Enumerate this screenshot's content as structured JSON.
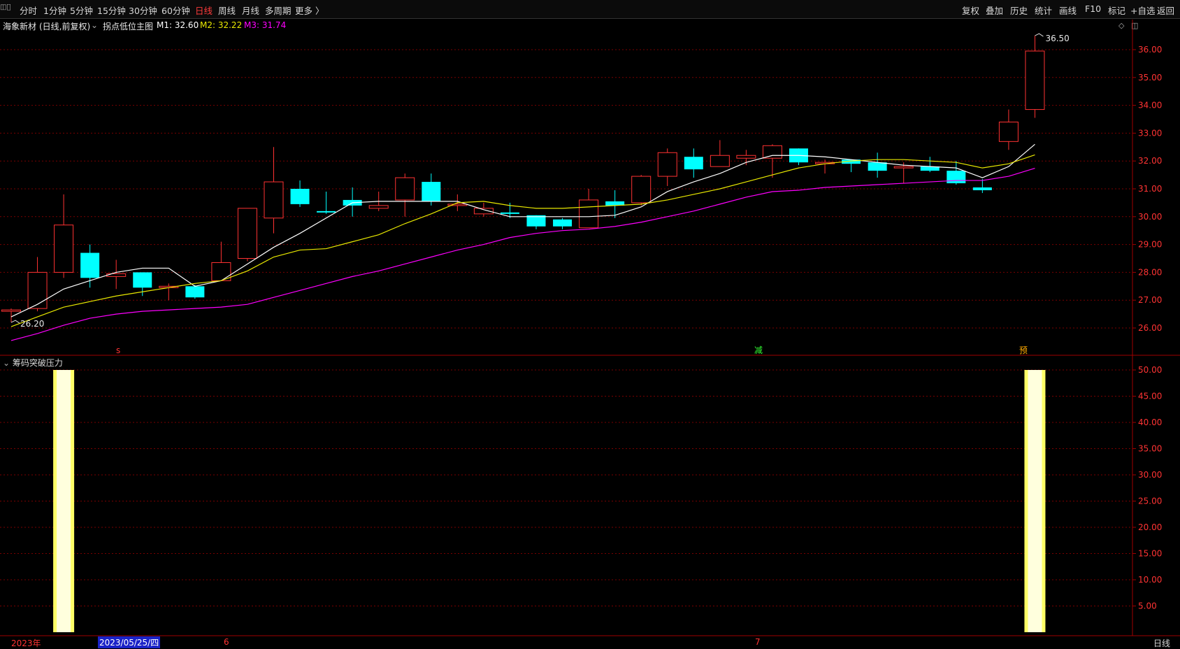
{
  "toolbar": {
    "left": [
      {
        "label": "分时",
        "active": false
      },
      {
        "label": "1分钟",
        "active": false
      },
      {
        "label": "5分钟",
        "active": false
      },
      {
        "label": "15分钟",
        "active": false
      },
      {
        "label": "30分钟",
        "active": false
      },
      {
        "label": "60分钟",
        "active": false
      },
      {
        "label": "日线",
        "active": true
      },
      {
        "label": "周线",
        "active": false
      },
      {
        "label": "月线",
        "active": false
      },
      {
        "label": "多周期",
        "active": false
      },
      {
        "label": "更多 〉",
        "active": false
      }
    ],
    "right": [
      "复权",
      "叠加",
      "历史",
      "统计",
      "画线",
      "F10",
      "标记",
      "+自选",
      "返回"
    ]
  },
  "info": {
    "stock": "海象新材",
    "period_desc": "(日线,前复权)",
    "indicator": "拐点低位主图",
    "m1": "M1: 32.60",
    "m2": "M2: 32.22",
    "m3": "M3: 31.74"
  },
  "indicator_panel": {
    "title": "筹码突破压力"
  },
  "bottom": {
    "year_label": "2023年",
    "selected_date": "2023/05/25/四",
    "month_6": "6",
    "month_7": "7",
    "period": "日线"
  },
  "markers": {
    "s": "s",
    "zeng": "减",
    "yu": "预"
  },
  "colors": {
    "up": "#ff3232",
    "down": "#00ffff",
    "m1": "#ffffff",
    "m2": "#e8e800",
    "m3": "#ff00ff",
    "grid": "#7a0000",
    "bar": "#ffff66"
  },
  "chart_data": [
    {
      "type": "candlestick",
      "title": "海象新材 (日线,前复权)",
      "y_ticks": [
        "26.00",
        "27.00",
        "28.00",
        "29.00",
        "30.00",
        "31.00",
        "32.00",
        "33.00",
        "34.00",
        "35.00",
        "36.00"
      ],
      "ylim": [
        25.4,
        36.8
      ],
      "high_label": "36.50",
      "low_label": "26.20",
      "candles": [
        {
          "o": 26.6,
          "c": 26.65,
          "h": 26.7,
          "l": 26.2
        },
        {
          "o": 26.7,
          "c": 28.0,
          "h": 28.55,
          "l": 26.6
        },
        {
          "o": 28.0,
          "c": 29.7,
          "h": 30.8,
          "l": 27.8
        },
        {
          "o": 28.7,
          "c": 27.8,
          "h": 29.0,
          "l": 27.45
        },
        {
          "o": 27.85,
          "c": 27.95,
          "h": 28.45,
          "l": 27.4
        },
        {
          "o": 28.0,
          "c": 27.45,
          "h": 28.0,
          "l": 27.15
        },
        {
          "o": 27.45,
          "c": 27.5,
          "h": 27.6,
          "l": 27.0
        },
        {
          "o": 27.5,
          "c": 27.1,
          "h": 27.55,
          "l": 27.05
        },
        {
          "o": 27.7,
          "c": 28.35,
          "h": 29.1,
          "l": 27.7
        },
        {
          "o": 28.5,
          "c": 30.3,
          "h": 30.3,
          "l": 28.4
        },
        {
          "o": 29.95,
          "c": 31.25,
          "h": 32.5,
          "l": 29.4
        },
        {
          "o": 31.0,
          "c": 30.45,
          "h": 31.3,
          "l": 30.35
        },
        {
          "o": 30.2,
          "c": 30.15,
          "h": 30.9,
          "l": 30.1
        },
        {
          "o": 30.6,
          "c": 30.4,
          "h": 31.05,
          "l": 30.0
        },
        {
          "o": 30.3,
          "c": 30.4,
          "h": 30.9,
          "l": 30.2
        },
        {
          "o": 30.6,
          "c": 31.4,
          "h": 31.55,
          "l": 30.0
        },
        {
          "o": 31.25,
          "c": 30.55,
          "h": 31.55,
          "l": 30.4
        },
        {
          "o": 30.4,
          "c": 30.45,
          "h": 30.8,
          "l": 30.2
        },
        {
          "o": 30.1,
          "c": 30.3,
          "h": 30.5,
          "l": 30.0
        },
        {
          "o": 30.15,
          "c": 30.1,
          "h": 30.5,
          "l": 29.95
        },
        {
          "o": 30.05,
          "c": 29.65,
          "h": 30.05,
          "l": 29.55
        },
        {
          "o": 29.9,
          "c": 29.65,
          "h": 29.95,
          "l": 29.55
        },
        {
          "o": 29.6,
          "c": 30.6,
          "h": 31.0,
          "l": 29.6
        },
        {
          "o": 30.55,
          "c": 30.4,
          "h": 30.95,
          "l": 29.95
        },
        {
          "o": 30.5,
          "c": 31.45,
          "h": 31.5,
          "l": 30.4
        },
        {
          "o": 31.45,
          "c": 32.3,
          "h": 32.45,
          "l": 31.1
        },
        {
          "o": 32.15,
          "c": 31.7,
          "h": 32.45,
          "l": 31.4
        },
        {
          "o": 31.8,
          "c": 32.2,
          "h": 32.75,
          "l": 31.8
        },
        {
          "o": 32.1,
          "c": 32.2,
          "h": 32.4,
          "l": 31.85
        },
        {
          "o": 32.1,
          "c": 32.55,
          "h": 32.6,
          "l": 31.4
        },
        {
          "o": 32.45,
          "c": 31.95,
          "h": 32.45,
          "l": 31.85
        },
        {
          "o": 31.9,
          "c": 31.95,
          "h": 32.05,
          "l": 31.55
        },
        {
          "o": 32.05,
          "c": 31.9,
          "h": 32.05,
          "l": 31.6
        },
        {
          "o": 31.95,
          "c": 31.65,
          "h": 32.3,
          "l": 31.4
        },
        {
          "o": 31.75,
          "c": 31.8,
          "h": 31.95,
          "l": 31.2
        },
        {
          "o": 31.8,
          "c": 31.65,
          "h": 32.15,
          "l": 31.6
        },
        {
          "o": 31.65,
          "c": 31.2,
          "h": 32.0,
          "l": 31.15
        },
        {
          "o": 31.05,
          "c": 30.95,
          "h": 31.35,
          "l": 30.85
        },
        {
          "o": 32.7,
          "c": 33.4,
          "h": 33.85,
          "l": 32.4
        },
        {
          "o": 33.85,
          "c": 35.95,
          "h": 36.5,
          "l": 33.55
        }
      ],
      "series": [
        {
          "name": "M1",
          "values": [
            26.4,
            26.85,
            27.4,
            27.7,
            28.0,
            28.15,
            28.15,
            27.5,
            27.7,
            28.3,
            28.9,
            29.4,
            29.95,
            30.5,
            30.55,
            30.55,
            30.55,
            30.55,
            30.25,
            30.0,
            30.0,
            30.0,
            30.0,
            30.05,
            30.35,
            30.9,
            31.25,
            31.55,
            31.95,
            32.2,
            32.2,
            32.15,
            32.05,
            31.95,
            31.85,
            31.8,
            31.75,
            31.4,
            31.8,
            32.6
          ]
        },
        {
          "name": "M2",
          "values": [
            26.05,
            26.4,
            26.75,
            26.95,
            27.15,
            27.3,
            27.45,
            27.6,
            27.7,
            28.05,
            28.55,
            28.8,
            28.85,
            29.1,
            29.35,
            29.75,
            30.1,
            30.5,
            30.55,
            30.4,
            30.3,
            30.3,
            30.35,
            30.4,
            30.45,
            30.6,
            30.8,
            31.0,
            31.25,
            31.5,
            31.75,
            31.9,
            32.0,
            32.05,
            32.05,
            32.0,
            31.95,
            31.75,
            31.9,
            32.22
          ]
        },
        {
          "name": "M3",
          "values": [
            25.55,
            25.8,
            26.1,
            26.35,
            26.5,
            26.6,
            26.65,
            26.7,
            26.75,
            26.85,
            27.1,
            27.35,
            27.6,
            27.85,
            28.05,
            28.3,
            28.55,
            28.8,
            29.0,
            29.25,
            29.4,
            29.5,
            29.55,
            29.65,
            29.8,
            30.0,
            30.2,
            30.45,
            30.7,
            30.9,
            30.95,
            31.05,
            31.1,
            31.15,
            31.2,
            31.25,
            31.3,
            31.3,
            31.45,
            31.74
          ]
        }
      ]
    },
    {
      "type": "bar",
      "title": "筹码突破压力",
      "y_ticks": [
        "5.00",
        "10.00",
        "15.00",
        "20.00",
        "25.00",
        "30.00",
        "35.00",
        "40.00",
        "45.00",
        "50.00"
      ],
      "ylim": [
        0,
        50
      ],
      "bars": [
        {
          "index": 2,
          "value": 50
        },
        {
          "index": 39,
          "value": 50
        }
      ]
    }
  ]
}
